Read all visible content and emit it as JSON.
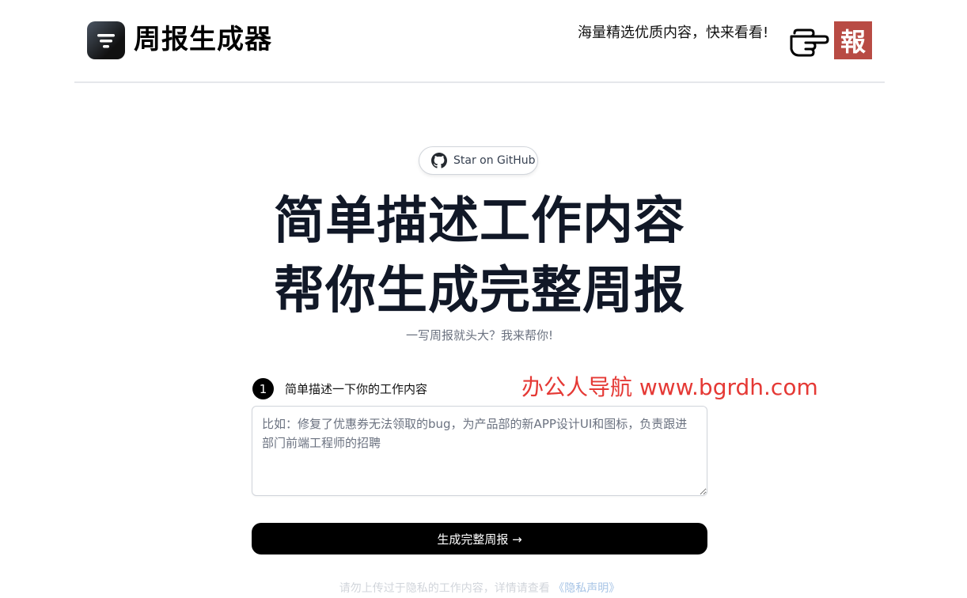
{
  "header": {
    "brand": "周报生成器",
    "promo": "海量精选优质内容，快来看看!",
    "badge": "報"
  },
  "github_button": {
    "label": "Star on GitHub"
  },
  "hero": {
    "title_line1": "简单描述工作内容",
    "title_line2": "帮你生成完整周报",
    "subtitle": "一写周报就头大？我来帮你!"
  },
  "step1": {
    "number": "1",
    "label": "简单描述一下你的工作内容"
  },
  "watermark": "办公人导航 www.bgrdh.com",
  "input": {
    "placeholder": "比如：修复了优惠券无法领取的bug，为产品部的新APP设计UI和图标，负责跟进部门前端工程师的招聘"
  },
  "generate_button": {
    "label": "生成完整周报 →"
  },
  "footer": {
    "privacy_text": "请勿上传过于隐私的工作内容，详情请查看",
    "privacy_link": "《隐私声明》"
  },
  "colors": {
    "primary": "#000000",
    "badge_bg": "#b84b44",
    "watermark": "#e53935",
    "heading": "#111827"
  }
}
